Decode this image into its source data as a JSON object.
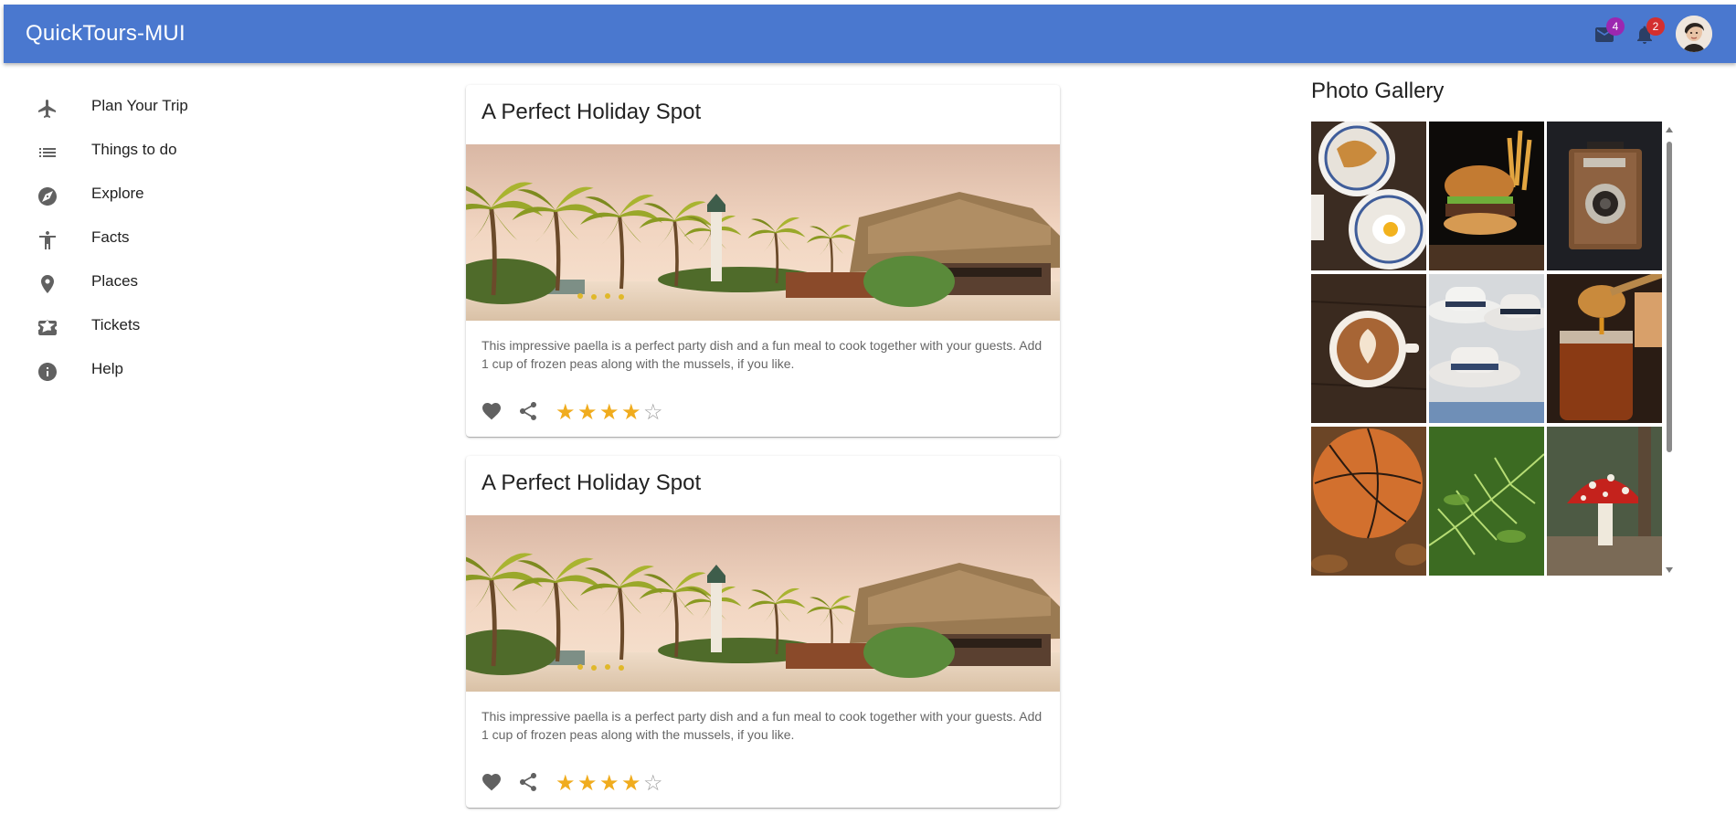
{
  "app": {
    "title": "QuickTours-MUI"
  },
  "header": {
    "mail_count": "4",
    "notification_count": "2",
    "mail_badge_color": "#9c27b0",
    "notification_badge_color": "#d32f2f"
  },
  "sidebar": {
    "items": [
      {
        "label": "Plan Your Trip",
        "icon": "airplane-icon"
      },
      {
        "label": "Things to do",
        "icon": "list-icon"
      },
      {
        "label": "Explore",
        "icon": "compass-icon"
      },
      {
        "label": "Facts",
        "icon": "accessibility-icon"
      },
      {
        "label": "Places",
        "icon": "place-pin-icon"
      },
      {
        "label": "Tickets",
        "icon": "ticket-star-icon"
      },
      {
        "label": "Help",
        "icon": "info-icon"
      }
    ]
  },
  "cards": [
    {
      "title": "A Perfect Holiday Spot",
      "description": "This impressive paella is a perfect party dish and a fun meal to cook together with your guests. Add 1 cup of frozen peas along with the mussels, if you like.",
      "rating": 4,
      "max_rating": 5
    },
    {
      "title": "A Perfect Holiday Spot",
      "description": "This impressive paella is a perfect party dish and a fun meal to cook together with your guests. Add 1 cup of frozen peas along with the mussels, if you like.",
      "rating": 4,
      "max_rating": 5
    }
  ],
  "gallery": {
    "title": "Photo Gallery",
    "photos": [
      "breakfast",
      "burger",
      "camera",
      "coffee",
      "hats",
      "honey",
      "basketball",
      "fern",
      "mushroom"
    ]
  },
  "colors": {
    "primary": "#4a78cf",
    "star": "#f0ac1e",
    "icon": "#616161"
  }
}
